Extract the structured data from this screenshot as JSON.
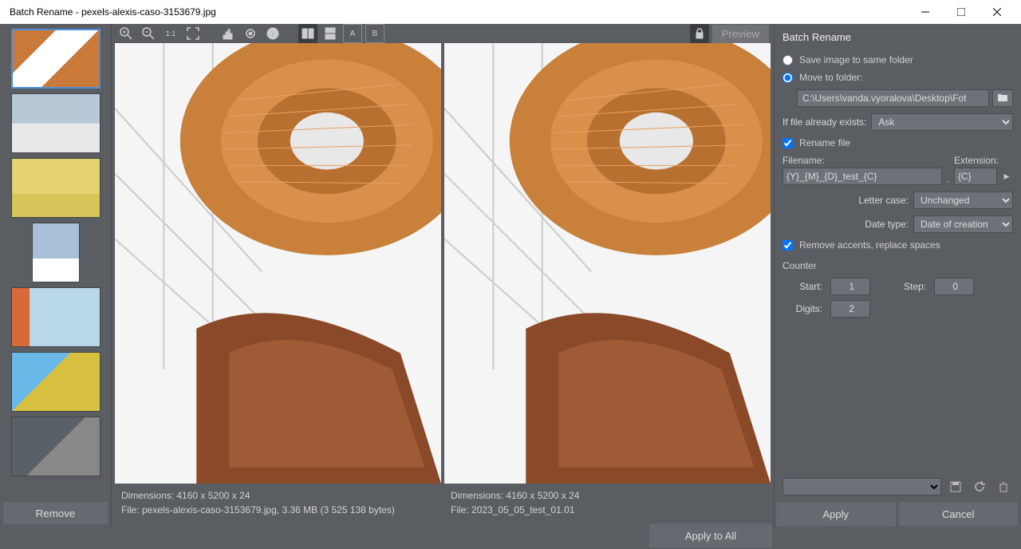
{
  "window": {
    "title": "Batch Rename - pexels-alexis-caso-3153679.jpg"
  },
  "thumbs": {
    "remove_label": "Remove"
  },
  "toolbar": {
    "preview_label": "Preview"
  },
  "preview_left": {
    "dimensions": "Dimensions: 4160 x 5200 x 24",
    "file": "File: pexels-alexis-caso-3153679.jpg, 3.36 MB (3 525 138 bytes)"
  },
  "preview_right": {
    "dimensions": "Dimensions: 4160 x 5200 x 24",
    "file": "File: 2023_05_05_test_01.01"
  },
  "buttons": {
    "apply_all": "Apply to All",
    "apply": "Apply",
    "cancel": "Cancel"
  },
  "panel": {
    "title": "Batch Rename",
    "save_same_folder": "Save image to same folder",
    "move_to_folder": "Move to folder:",
    "folder_path": "C:\\Users\\vanda.vyoralova\\Desktop\\Fot",
    "if_exists_label": "If file already exists:",
    "if_exists_value": "Ask",
    "rename_file": "Rename file",
    "filename_label": "Filename:",
    "filename_value": "{Y}_{M}_{D}_test_{C}",
    "extension_label": "Extension:",
    "extension_value": "{C}",
    "letter_case_label": "Letter case:",
    "letter_case_value": "Unchanged",
    "date_type_label": "Date type:",
    "date_type_value": "Date of creation",
    "remove_accents": "Remove accents, replace spaces",
    "counter_title": "Counter",
    "start_label": "Start:",
    "start_value": "1",
    "step_label": "Step:",
    "step_value": "0",
    "digits_label": "Digits:",
    "digits_value": "2"
  }
}
